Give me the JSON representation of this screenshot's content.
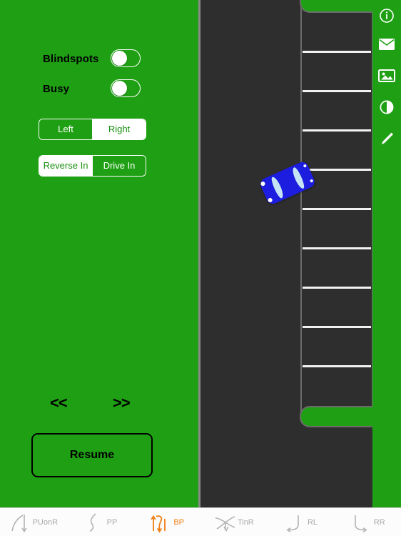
{
  "colors": {
    "panel_green": "#1fa014",
    "asphalt": "#2e2e2e",
    "line_white": "#f2f2f2",
    "car_blue": "#1d1de0",
    "accent_orange": "#f07d12",
    "tab_inactive": "#a8a8a8"
  },
  "panel": {
    "toggles": [
      {
        "label": "Blindspots",
        "state": "off"
      },
      {
        "label": "Busy",
        "state": "off"
      }
    ],
    "side_selector": {
      "name": "side",
      "options": [
        "Left",
        "Right"
      ],
      "selected": "Right"
    },
    "maneuver_selector": {
      "name": "maneuver",
      "options": [
        "Reverse In",
        "Drive In"
      ],
      "selected": "Reverse In"
    },
    "nav": {
      "prev_label": "<<",
      "next_label": ">>"
    },
    "resume_label": "Resume"
  },
  "scene": {
    "bay_count": 8,
    "vehicle": {
      "color": "#1d1de0",
      "heading_deg": -24
    }
  },
  "rail": {
    "items": [
      {
        "icon": "info-icon"
      },
      {
        "icon": "mail-icon"
      },
      {
        "icon": "image-icon"
      },
      {
        "icon": "contrast-icon"
      },
      {
        "icon": "pencil-icon"
      }
    ]
  },
  "tabbar": {
    "tabs": [
      {
        "label": "PUonR",
        "icon": "pull-up-on-right-icon",
        "active": false
      },
      {
        "label": "PP",
        "icon": "parallel-park-icon",
        "active": false
      },
      {
        "label": "BP",
        "icon": "bay-park-icon",
        "active": true
      },
      {
        "label": "TinR",
        "icon": "turn-in-road-icon",
        "active": false
      },
      {
        "label": "RL",
        "icon": "reverse-left-icon",
        "active": false
      },
      {
        "label": "RR",
        "icon": "reverse-right-icon",
        "active": false
      }
    ]
  }
}
